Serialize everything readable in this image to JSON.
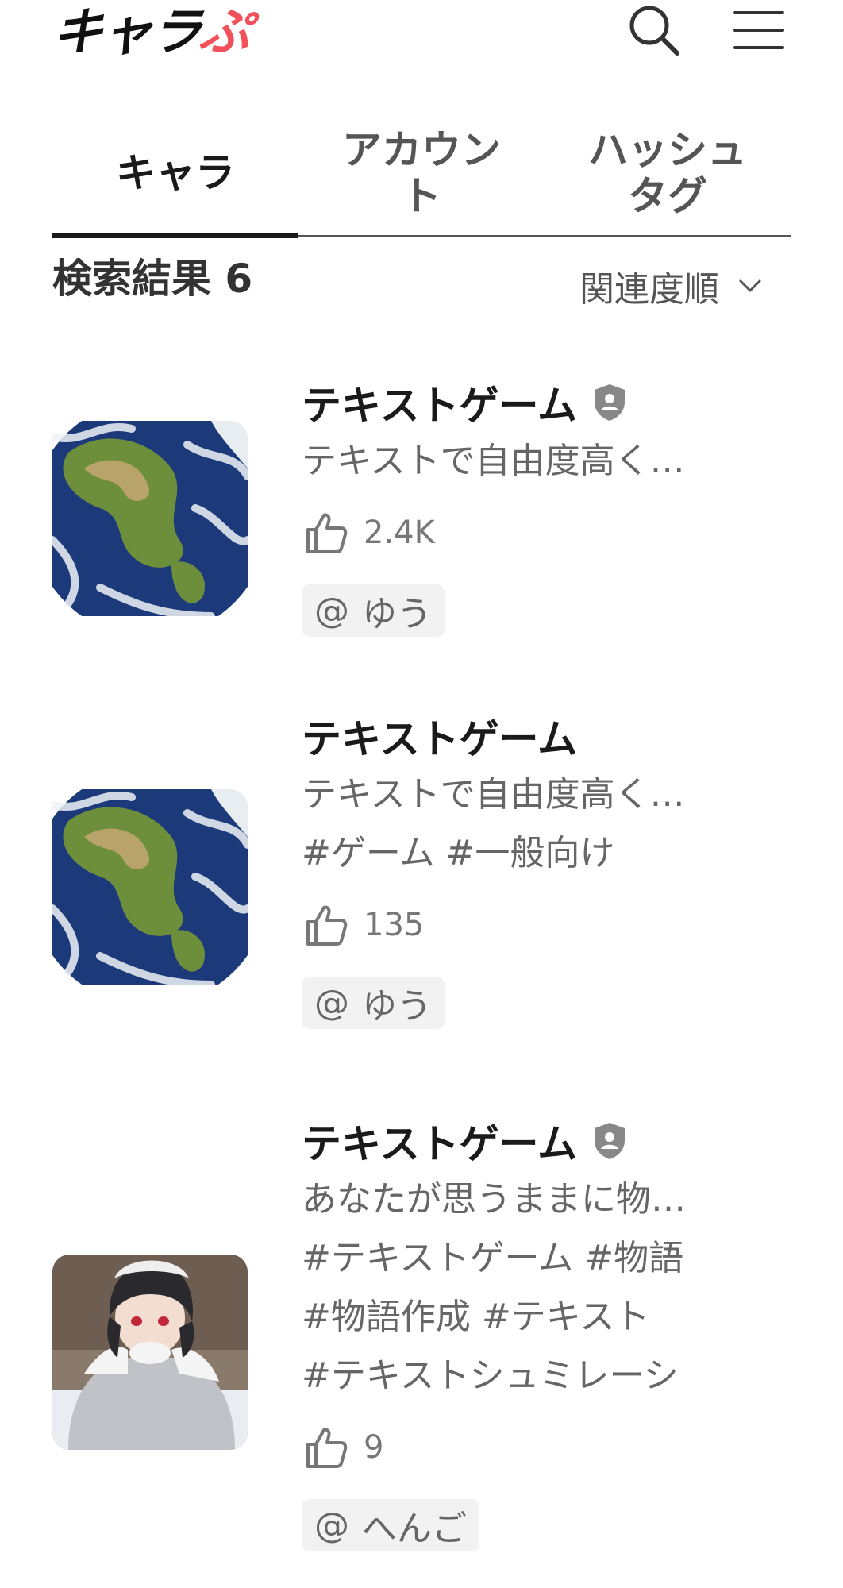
{
  "header": {
    "logo_main": "キャラ",
    "logo_accent": "ぷ",
    "search_icon": "search-icon",
    "menu_icon": "hamburger-menu-icon"
  },
  "tabs": [
    {
      "label": "キャラ",
      "active": true
    },
    {
      "label": "アカウント",
      "active": false
    },
    {
      "label": "ハッシュタグ",
      "active": false
    }
  ],
  "results": {
    "count_label": "検索結果",
    "count": "6",
    "sort_label": "関連度順",
    "sort_icon": "chevron-down-icon"
  },
  "cards": [
    {
      "title": "テキストゲーム",
      "verified": true,
      "description": "テキストで自由度高く…",
      "tags": [],
      "likes": "2.4K",
      "author_prefix": "@",
      "author": "ゆう",
      "thumbnail": "earth-image"
    },
    {
      "title": "テキストゲーム",
      "verified": false,
      "description": "テキストで自由度高く…",
      "tags": [
        "#ゲーム #一般向け"
      ],
      "likes": "135",
      "author_prefix": "@",
      "author": "ゆう",
      "thumbnail": "earth-image"
    },
    {
      "title": "テキストゲーム",
      "verified": true,
      "description": "あなたが思うままに物…",
      "tags": [
        "#テキストゲーム #物語",
        "#物語作成 #テキスト",
        "#テキストシュミレーシ"
      ],
      "likes": "9",
      "author_prefix": "@",
      "author": "へんご",
      "thumbnail": "anime-girl-image"
    }
  ],
  "colors": {
    "accent": "#f2505a",
    "text": "#1a1a1a",
    "muted": "#666666",
    "chip_bg": "#f2f2f2"
  }
}
